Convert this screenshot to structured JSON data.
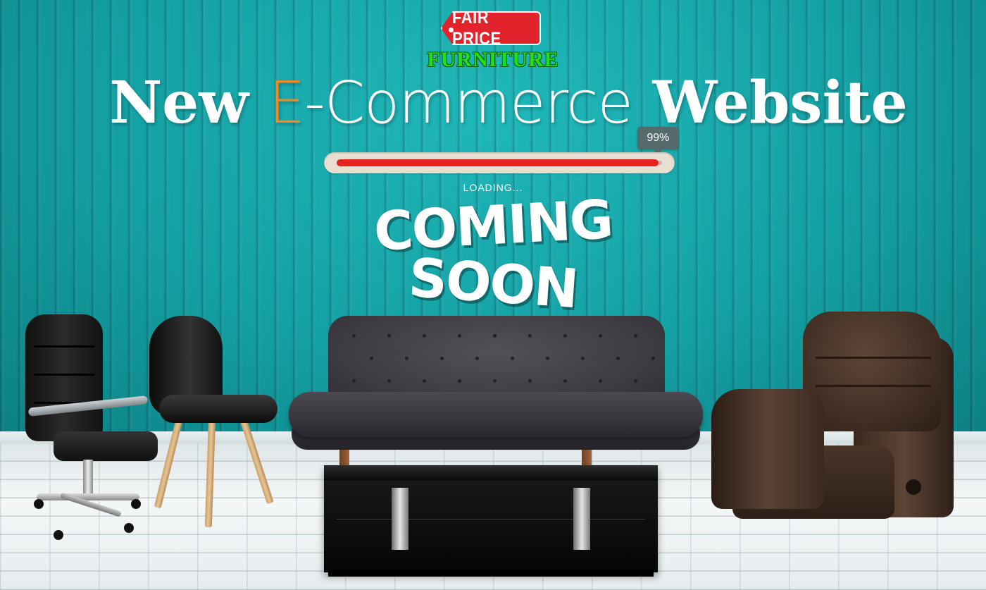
{
  "brand": {
    "tag_text": "FAIR PRICE",
    "subtitle": "FURNITURE",
    "tag_color": "#e3232b",
    "subtitle_color": "#1ee11e"
  },
  "headline": {
    "part1": "New ",
    "part2_accent": "E",
    "part2_rest": "-Commerce",
    "part3": " Website",
    "accent_color": "#f08a24"
  },
  "progress": {
    "percent": 99,
    "label": "99%",
    "status_text": "LOADING...",
    "fill_color": "#e8231e"
  },
  "announcement": {
    "line1": "COMING",
    "line2": "SOON"
  },
  "colors": {
    "wall": "#1aa3a5",
    "floor": "#eef2f3"
  }
}
